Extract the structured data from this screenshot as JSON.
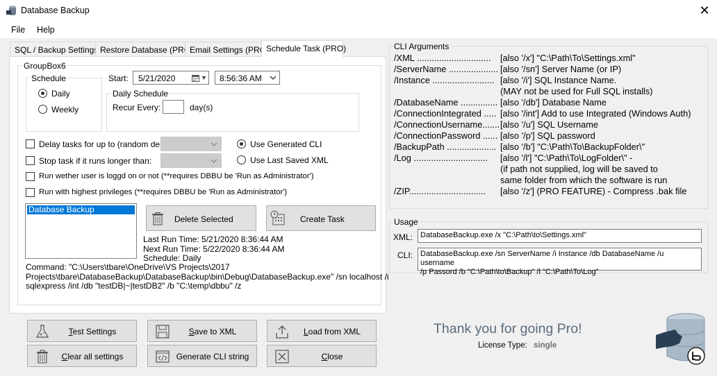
{
  "window": {
    "title": "Database Backup",
    "close": "✕"
  },
  "menu": {
    "file": "File",
    "help": "Help"
  },
  "tabs": [
    {
      "label": "SQL / Backup Settings"
    },
    {
      "label": "Restore Database (PRO)"
    },
    {
      "label": "Email Settings (PRO)"
    },
    {
      "label": "Schedule Task (PRO)"
    }
  ],
  "schedule": {
    "group_label": "GroupBox6",
    "schedule_label": "Schedule",
    "daily": "Daily",
    "weekly": "Weekly",
    "selected": "Daily",
    "start_label": "Start:",
    "start_date": "5/21/2020",
    "start_time": "8:56:36 AM",
    "daily_schedule_label": "Daily Schedule",
    "recur_label": "Recur Every:",
    "recur_value": "",
    "recur_unit": "day(s)"
  },
  "options": {
    "delay_label": "Delay tasks for up to (random delay):",
    "stop_label": "Stop task if it runs longer than:",
    "run_whether_label": "Run wether user is loggd on or not (**requires DBBU be 'Run as Administrator')",
    "highest_label": "Run with highest privileges (**requires DBBU be 'Run as Administrator')",
    "use_generated": "Use Generated CLI",
    "use_last_saved": "Use Last Saved XML"
  },
  "tasks": {
    "items": [
      "Database Backup"
    ],
    "delete_label": "Delete Selected",
    "create_label": "Create Task",
    "last_run": "Last Run Time: 5/21/2020 8:36:44 AM",
    "next_run": "Next Run Time: 5/22/2020 8:36:44 AM",
    "schedule": "Schedule: Daily",
    "command_line1": "Command: \"C:\\Users\\tbare\\OneDrive\\VS Projects\\2017",
    "command_line2": "Projects\\tbare\\DatabaseBackup\\DatabaseBackup\\bin\\Debug\\DatabaseBackup.exe\" /sn localhost /i",
    "command_line3": "sqlexpress /int /db \"testDB|~|testDB2\" /b \"C:\\temp\\dbbu\" /z"
  },
  "cli": {
    "group_label": "CLI Arguments",
    "rows": [
      {
        "arg": "/XML ..............................",
        "desc": "[also '/x'] \"C:\\Path\\To\\Settings.xml\""
      },
      {
        "arg": "/ServerName ....................",
        "desc": "[also '/sn'] Server Name (or IP)"
      },
      {
        "arg": "/Instance .........................",
        "desc": "[also '/i'] SQL Instance Name."
      },
      {
        "arg": "",
        "desc": "(MAY not be used for Full SQL installs)"
      },
      {
        "arg": "/DatabaseName ...............",
        "desc": "[also '/db'] Database Name"
      },
      {
        "arg": "/ConnectionIntegrated .....",
        "desc": "[also '/int'] Add to use Integrated (Windows Auth)"
      },
      {
        "arg": "/ConnectionUsername.......",
        "desc": "[also '/u'] SQL Username"
      },
      {
        "arg": "/ConnectionPassword ......",
        "desc": "[also '/p'] SQL password"
      },
      {
        "arg": "/BackupPath ....................",
        "desc": "[also '/b'] \"C:\\Path\\To\\BackupFolder\\\""
      },
      {
        "arg": "/Log ..............................",
        "desc": "[also '/l'] \"C:\\Path\\To\\LogFolder\\\" -"
      },
      {
        "arg": "",
        "desc": "(if path not supplied, log will be saved to"
      },
      {
        "arg": "",
        "desc": "same folder from which the software is run"
      },
      {
        "arg": "/ZIP...............................",
        "desc": "[also '/z'] (PRO FEATURE) - Compress .bak file"
      }
    ]
  },
  "usage": {
    "group_label": "Usage",
    "xml_label": "XML:",
    "xml_value": "DatabaseBackup.exe /x \"C:\\Path\\to\\Settings.xml\"",
    "cli_label": "CLI:",
    "cli_line1": "DatabaseBackup.exe /sn ServerName /i Instance /db DatabaseName /u username",
    "cli_line2": "/p Passord /b \"C:\\Path\\to\\Backup\" /l \"C:\\Path\\To\\Log\""
  },
  "buttons": {
    "test_u": "T",
    "test_rest": "est Settings",
    "save_u": "S",
    "save_rest": "ave to XML",
    "load_u": "L",
    "load_rest": "oad from XML",
    "clear_u": "C",
    "clear_rest": "lear all settings",
    "generate": "Generate CLI string",
    "close_u": "C",
    "close_rest": "lose"
  },
  "pro": {
    "thanks": "Thank you for going Pro!",
    "license_label": "License Type:",
    "license_value": "single",
    "thanks_color": "#5b6b7b",
    "license_color": "#6d6d6d"
  }
}
